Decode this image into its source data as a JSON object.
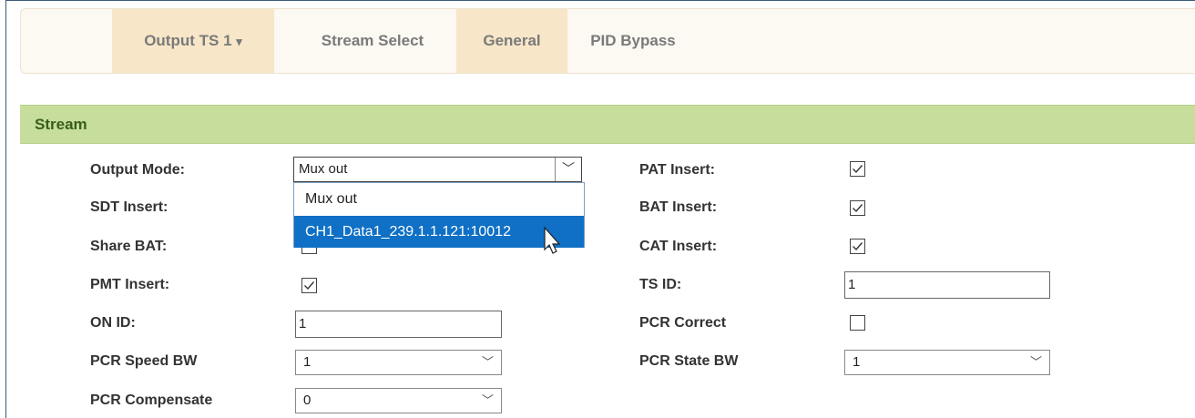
{
  "tabs": [
    {
      "label": "Output TS 1",
      "caret": "▾"
    },
    {
      "label": "Stream Select"
    },
    {
      "label": "General"
    },
    {
      "label": "PID Bypass"
    }
  ],
  "section": {
    "title": "Stream"
  },
  "fields": {
    "output_mode": {
      "label": "Output Mode:",
      "value": "Mux out"
    },
    "output_mode_options": [
      "Mux out",
      "CH1_Data1_239.1.1.121:10012"
    ],
    "sdt_insert": {
      "label": "SDT Insert:"
    },
    "share_bat": {
      "label": "Share BAT:"
    },
    "pmt_insert": {
      "label": "PMT Insert:",
      "checked": true
    },
    "on_id": {
      "label": "ON ID:",
      "value": "1"
    },
    "pcr_speed_bw": {
      "label": "PCR Speed BW",
      "value": "1"
    },
    "pcr_compensate": {
      "label": "PCR Compensate",
      "value": "0"
    },
    "pat_insert": {
      "label": "PAT Insert:",
      "checked": true
    },
    "bat_insert": {
      "label": "BAT Insert:",
      "checked": true
    },
    "cat_insert": {
      "label": "CAT Insert:",
      "checked": true
    },
    "ts_id": {
      "label": "TS ID:",
      "value": "1"
    },
    "pcr_correct": {
      "label": "PCR Correct",
      "checked": false
    },
    "pcr_state_bw": {
      "label": "PCR State BW",
      "value": "1"
    }
  },
  "icons": {
    "check": "check-icon",
    "dropdown": "chevron-down-icon",
    "cursor": "mouse-pointer-icon"
  },
  "colors": {
    "section_bg": "#c6dd9b",
    "active_tab_bg": "#f7e6c8",
    "option_highlight": "#0f70c5"
  }
}
